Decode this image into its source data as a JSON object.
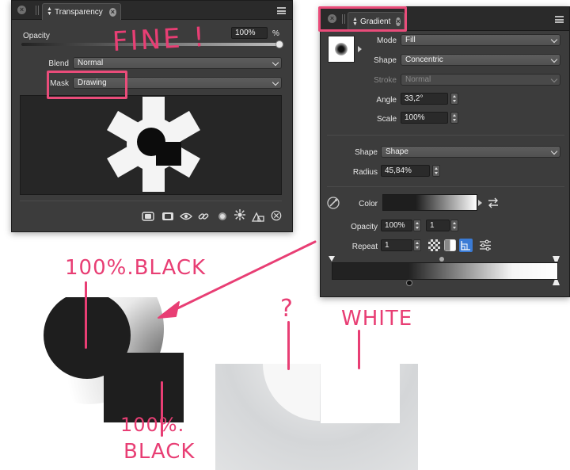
{
  "transparency_panel": {
    "tab_label": "Transparency",
    "opacity_label": "Opacity",
    "opacity_value": "100%",
    "opacity_unit": "%",
    "opacity_level": 1.0,
    "blend_label": "Blend",
    "blend_value": "Normal",
    "mask_label": "Mask",
    "mask_value": "Drawing"
  },
  "gradient_panel": {
    "tab_label": "Gradient",
    "mode_label": "Mode",
    "mode_value": "Fill",
    "shape_label": "Shape",
    "shape_value": "Concentric",
    "stroke_label": "Stroke",
    "stroke_value": "Normal",
    "angle_label": "Angle",
    "angle_value": "33,2°",
    "scale_label": "Scale",
    "scale_value": "100%",
    "shape2_label": "Shape",
    "shape2_value": "Shape",
    "radius_label": "Radius",
    "radius_value": "45,84%",
    "color_label": "Color",
    "opacity_label": "Opacity",
    "opacity_value": "100%",
    "opacity_step": "1",
    "repeat_label": "Repeat",
    "repeat_value": "1"
  },
  "annotations": {
    "fine": "FINE !",
    "black_top": "100%.BLACK",
    "black_bottom_1": "100%.",
    "black_bottom_2": "BLACK",
    "question": "?",
    "white": "WHITE"
  },
  "colors": {
    "annotation_pink": "#e83e74",
    "panel_bg": "#3c3c3c",
    "selected_blue": "#3a7bd5"
  }
}
